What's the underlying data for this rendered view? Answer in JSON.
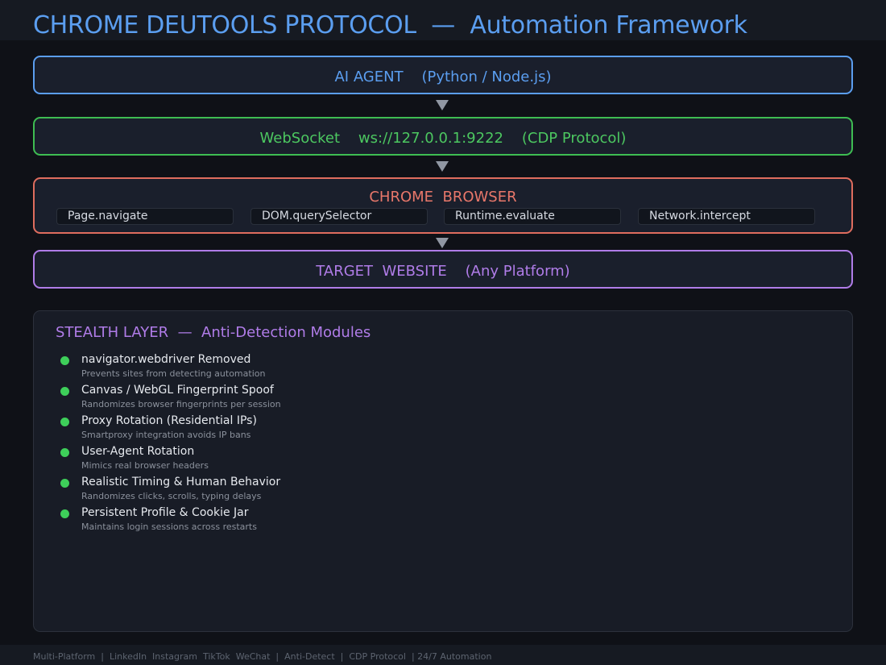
{
  "header": {
    "title": "CHROME DEUTOOLS PROTOCOL  —  Automation Framework"
  },
  "layers": {
    "agent": {
      "label": "AI AGENT    (Python / Node.js)"
    },
    "websocket": {
      "label": "WebSocket    ws://127.0.0.1:9222    (CDP Protocol)"
    },
    "chrome": {
      "label": "CHROME  BROWSER",
      "apis": [
        "Page.navigate",
        "DOM.querySelector",
        "Runtime.evaluate",
        "Network.intercept"
      ]
    },
    "target": {
      "label": "TARGET  WEBSITE    (Any Platform)"
    }
  },
  "stealth": {
    "title": "STEALTH LAYER  —  Anti-Detection Modules",
    "items": [
      {
        "name": "navigator.webdriver Removed",
        "desc": "Prevents sites from detecting automation"
      },
      {
        "name": "Canvas / WebGL Fingerprint Spoof",
        "desc": "Randomizes browser fingerprints per session"
      },
      {
        "name": "Proxy Rotation (Residential IPs)",
        "desc": "Smartproxy integration avoids IP bans"
      },
      {
        "name": "User-Agent Rotation",
        "desc": "Mimics real browser headers"
      },
      {
        "name": "Realistic Timing & Human Behavior",
        "desc": "Randomizes clicks, scrolls, typing delays"
      },
      {
        "name": "Persistent Profile & Cookie Jar",
        "desc": "Maintains login sessions across restarts"
      }
    ]
  },
  "footer": {
    "text": "Multi-Platform  |  LinkedIn  Instagram  TikTok  WeChat  |  Anti-Detect  |  CDP Protocol  | 24/7 Automation"
  },
  "colors": {
    "agent": "#5b9ef0",
    "websocket": "#3ebd52",
    "chrome": "#df6d5e",
    "target": "#b07ce8",
    "stealth_title": "#b07ce8",
    "bullet": "#3ecf5a"
  }
}
